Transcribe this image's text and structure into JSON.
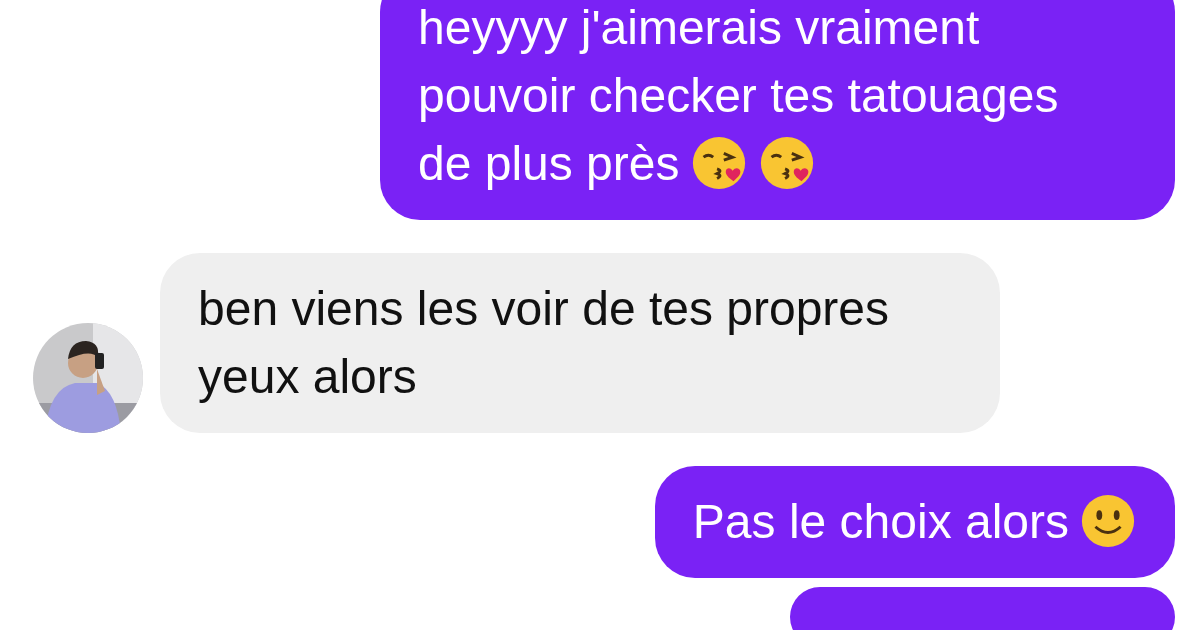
{
  "messages": [
    {
      "sent": true,
      "lines": [
        "heyyyy j'aimerais vraiment",
        "pouvoir checker tes tatouages",
        "de plus près"
      ],
      "emojis": [
        {
          "kind": "kiss"
        },
        {
          "kind": "kiss"
        }
      ]
    },
    {
      "sent": false,
      "lines": [
        "ben viens les voir de tes propres",
        "yeux alors"
      ],
      "avatar": {
        "kind": "picture"
      }
    },
    {
      "sent": true,
      "lines": [
        "Pas le choix alors"
      ],
      "emojis": [
        {
          "kind": "smile"
        }
      ]
    },
    {
      "sent": true
    }
  ]
}
